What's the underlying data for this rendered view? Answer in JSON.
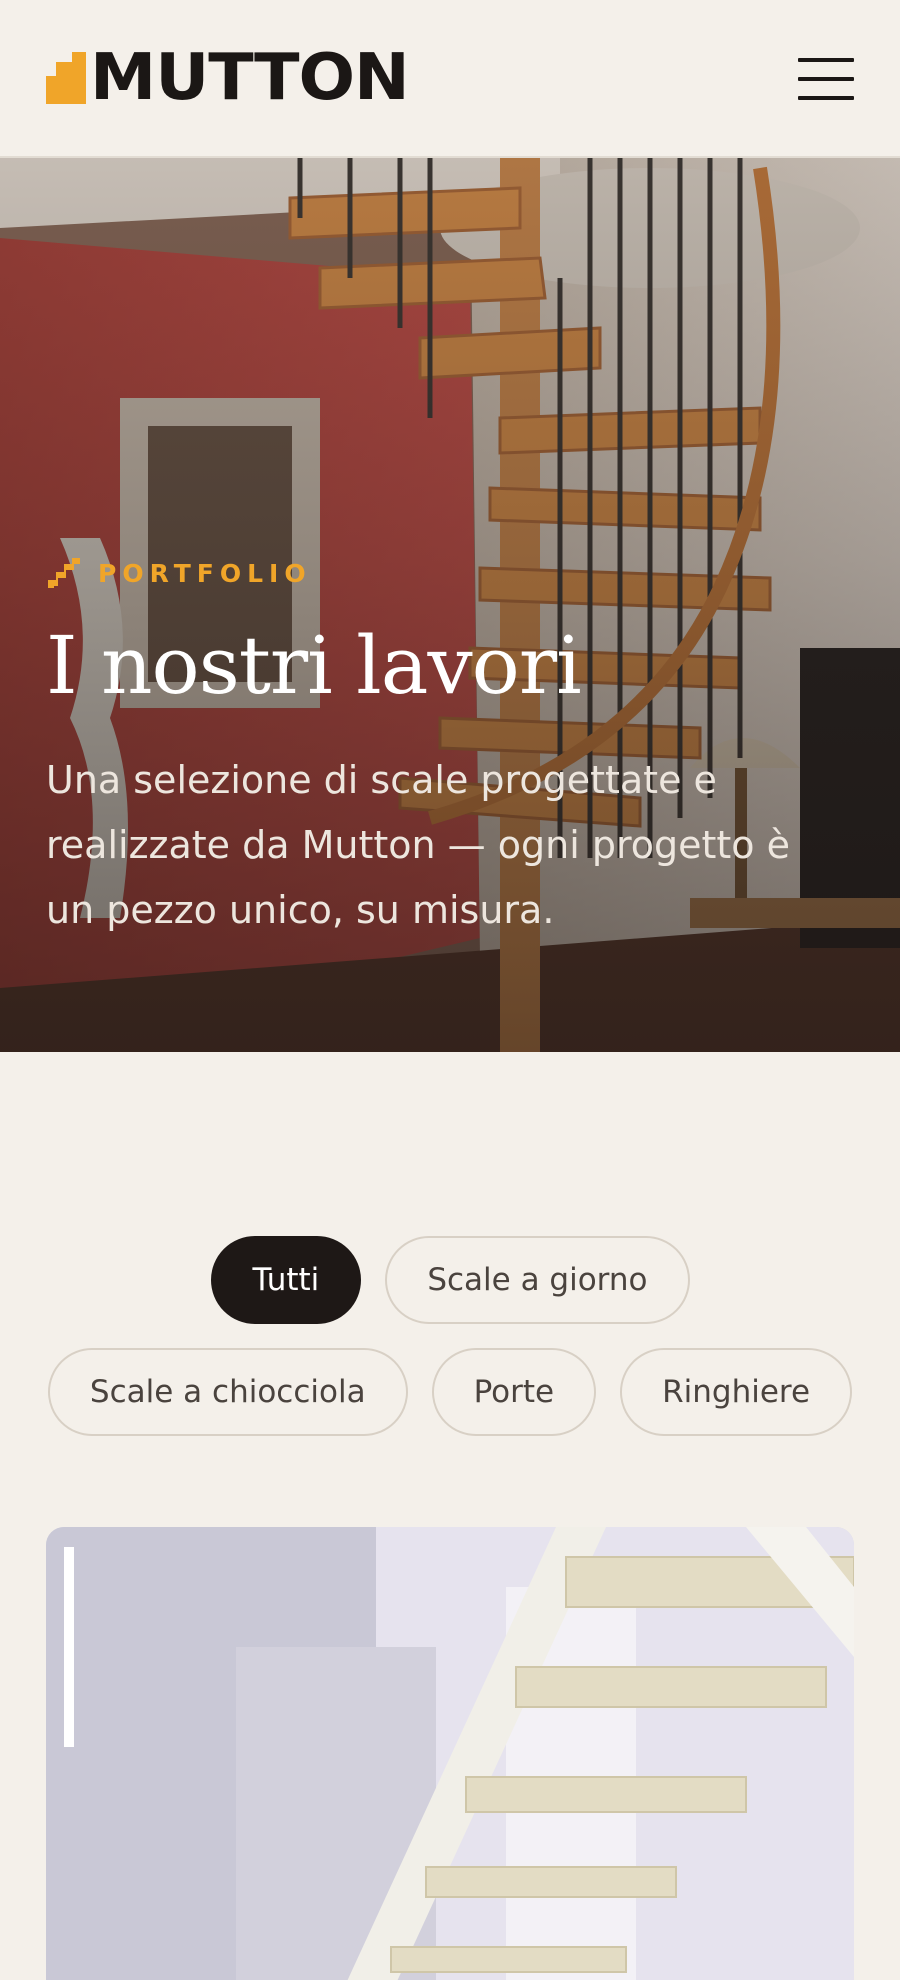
{
  "header": {
    "logo_text": "MUTTON",
    "menu_icon": "hamburger-menu-icon"
  },
  "hero": {
    "eyebrow_icon": "stair-icon",
    "eyebrow": "PORTFOLIO",
    "title": "I nostri lavori",
    "subtitle": "Una selezione di scale progettate e realizzate da Mutton — ogni progetto è un pezzo unico, su misura."
  },
  "filters": {
    "active": "Tutti",
    "row1": [
      "Tutti",
      "Scale a giorno"
    ],
    "row2": [
      "Scale a chiocciola",
      "Porte",
      "Ringhiere"
    ]
  },
  "colors": {
    "accent": "#f0a529",
    "background": "#f4f0ea",
    "dark": "#1e1816"
  }
}
